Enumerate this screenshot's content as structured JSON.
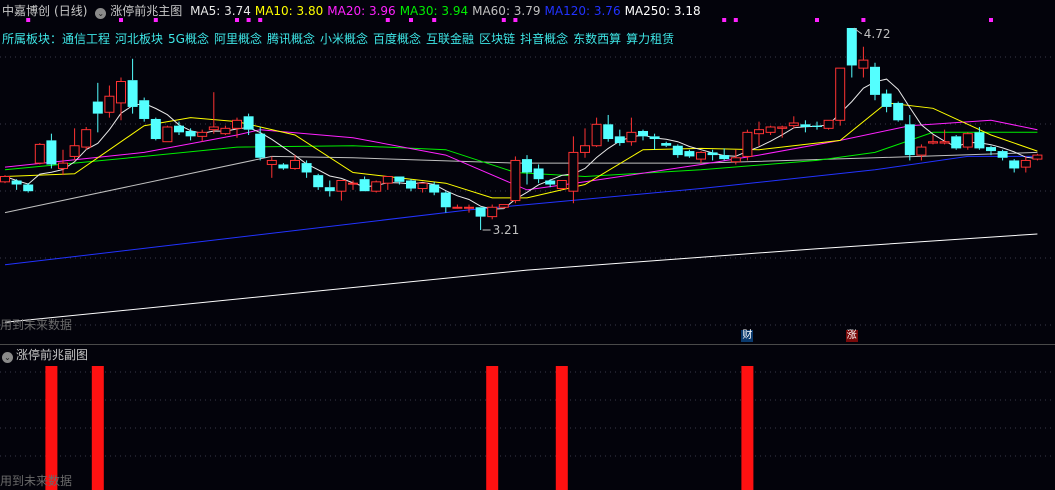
{
  "header": {
    "stock_name": "中嘉博创",
    "period": "(日线)",
    "indicator": "涨停前兆主图",
    "ma": [
      {
        "label": "MA5: 3.74",
        "color": "#e8e8e8"
      },
      {
        "label": "MA10: 3.80",
        "color": "#ffff00"
      },
      {
        "label": "MA20: 3.96",
        "color": "#ff22ff"
      },
      {
        "label": "MA30: 3.94",
        "color": "#00ee00"
      },
      {
        "label": "MA60: 3.79",
        "color": "#c0c0c0"
      },
      {
        "label": "MA120: 3.76",
        "color": "#2233ff"
      },
      {
        "label": "MA250: 3.18",
        "color": "#ffffff"
      }
    ]
  },
  "sectors": {
    "label": "所属板块：",
    "items": [
      "通信工程",
      "河北板块",
      "5G概念",
      "阿里概念",
      "腾讯概念",
      "小米概念",
      "百度概念",
      "互联金融",
      "区块链",
      "抖音概念",
      "东数西算",
      "算力租赁"
    ]
  },
  "warning_label": "用到未来数据",
  "sub_panel": {
    "title": "涨停前兆副图",
    "signal_bars": [
      4,
      8,
      42,
      48,
      64
    ],
    "bar_color": "#ff1111"
  },
  "badges": [
    {
      "text": "财",
      "index": 64,
      "color": "#0a3a6e"
    },
    {
      "text": "涨",
      "index": 73,
      "color": "#7a0a0a"
    }
  ],
  "chart_data": {
    "type": "candlestick",
    "up_color": "#ff3333",
    "down_color": "#54ffff",
    "price_range": [
      2.4,
      4.86
    ],
    "high_label": {
      "index": 73,
      "text": "4.72"
    },
    "low_label": {
      "index": 41,
      "text": "3.21"
    },
    "signal_dots": [
      2,
      10,
      13,
      20,
      21,
      22,
      33,
      35,
      37,
      43,
      44,
      62,
      63,
      70,
      74,
      85
    ],
    "ohlc": [
      [
        3.57,
        3.62,
        3.56,
        3.61
      ],
      [
        3.58,
        3.59,
        3.51,
        3.55
      ],
      [
        3.55,
        3.56,
        3.49,
        3.5
      ],
      [
        3.71,
        3.86,
        3.7,
        3.85
      ],
      [
        3.88,
        3.93,
        3.67,
        3.7
      ],
      [
        3.67,
        3.81,
        3.62,
        3.71
      ],
      [
        3.76,
        3.97,
        3.73,
        3.84
      ],
      [
        3.83,
        3.98,
        3.81,
        3.96
      ],
      [
        4.17,
        4.31,
        3.94,
        4.08
      ],
      [
        4.09,
        4.29,
        4.05,
        4.21
      ],
      [
        4.16,
        4.35,
        4.03,
        4.32
      ],
      [
        4.33,
        4.49,
        4.08,
        4.13
      ],
      [
        4.18,
        4.2,
        4.02,
        4.04
      ],
      [
        4.04,
        4.05,
        3.88,
        3.89
      ],
      [
        3.87,
        3.99,
        3.87,
        3.98
      ],
      [
        3.99,
        4.02,
        3.92,
        3.94
      ],
      [
        3.95,
        3.97,
        3.88,
        3.91
      ],
      [
        3.91,
        3.96,
        3.87,
        3.94
      ],
      [
        3.96,
        4.24,
        3.93,
        3.98
      ],
      [
        3.93,
        3.99,
        3.92,
        3.97
      ],
      [
        3.97,
        4.05,
        3.9,
        4.03
      ],
      [
        4.06,
        4.08,
        3.92,
        3.96
      ],
      [
        3.93,
        3.98,
        3.73,
        3.75
      ],
      [
        3.7,
        3.76,
        3.6,
        3.73
      ],
      [
        3.7,
        3.71,
        3.66,
        3.67
      ],
      [
        3.67,
        3.77,
        3.66,
        3.73
      ],
      [
        3.71,
        3.73,
        3.6,
        3.64
      ],
      [
        3.62,
        3.63,
        3.51,
        3.53
      ],
      [
        3.53,
        3.58,
        3.46,
        3.5
      ],
      [
        3.5,
        3.58,
        3.43,
        3.58
      ],
      [
        3.56,
        3.58,
        3.51,
        3.56
      ],
      [
        3.59,
        3.61,
        3.5,
        3.5
      ],
      [
        3.5,
        3.58,
        3.49,
        3.57
      ],
      [
        3.56,
        3.61,
        3.51,
        3.61
      ],
      [
        3.61,
        3.61,
        3.55,
        3.57
      ],
      [
        3.58,
        3.59,
        3.5,
        3.52
      ],
      [
        3.52,
        3.56,
        3.49,
        3.56
      ],
      [
        3.55,
        3.57,
        3.47,
        3.49
      ],
      [
        3.49,
        3.5,
        3.34,
        3.38
      ],
      [
        3.38,
        3.4,
        3.37,
        3.38
      ],
      [
        3.38,
        3.4,
        3.34,
        3.38
      ],
      [
        3.38,
        3.38,
        3.21,
        3.31
      ],
      [
        3.31,
        3.4,
        3.29,
        3.38
      ],
      [
        3.38,
        3.4,
        3.37,
        3.4
      ],
      [
        3.43,
        3.76,
        3.41,
        3.73
      ],
      [
        3.74,
        3.77,
        3.55,
        3.64
      ],
      [
        3.67,
        3.7,
        3.56,
        3.59
      ],
      [
        3.58,
        3.59,
        3.53,
        3.55
      ],
      [
        3.52,
        3.58,
        3.51,
        3.58
      ],
      [
        3.5,
        3.91,
        3.41,
        3.79
      ],
      [
        3.79,
        3.97,
        3.75,
        3.84
      ],
      [
        3.84,
        4.05,
        3.83,
        4.0
      ],
      [
        4.0,
        4.07,
        3.87,
        3.89
      ],
      [
        3.91,
        3.96,
        3.84,
        3.86
      ],
      [
        3.87,
        4.05,
        3.84,
        3.94
      ],
      [
        3.95,
        3.96,
        3.88,
        3.91
      ],
      [
        3.91,
        3.93,
        3.81,
        3.89
      ],
      [
        3.86,
        3.87,
        3.83,
        3.84
      ],
      [
        3.84,
        3.85,
        3.75,
        3.77
      ],
      [
        3.8,
        3.81,
        3.75,
        3.76
      ],
      [
        3.74,
        3.8,
        3.71,
        3.79
      ],
      [
        3.79,
        3.81,
        3.73,
        3.77
      ],
      [
        3.77,
        3.82,
        3.73,
        3.74
      ],
      [
        3.72,
        3.81,
        3.7,
        3.75
      ],
      [
        3.76,
        3.96,
        3.73,
        3.94
      ],
      [
        3.93,
        4.02,
        3.84,
        3.96
      ],
      [
        3.94,
        3.99,
        3.92,
        3.98
      ],
      [
        3.97,
        3.99,
        3.9,
        3.98
      ],
      [
        3.99,
        4.06,
        3.97,
        4.01
      ],
      [
        4.0,
        4.03,
        3.94,
        3.98
      ],
      [
        3.99,
        4.02,
        3.96,
        3.98
      ],
      [
        3.97,
        4.03,
        3.96,
        4.03
      ],
      [
        4.03,
        4.42,
        3.99,
        4.42
      ],
      [
        4.72,
        4.72,
        4.35,
        4.44
      ],
      [
        4.42,
        4.58,
        4.35,
        4.48
      ],
      [
        4.43,
        4.46,
        4.18,
        4.22
      ],
      [
        4.23,
        4.26,
        4.09,
        4.13
      ],
      [
        4.16,
        4.17,
        4.02,
        4.03
      ],
      [
        4.0,
        4.07,
        3.73,
        3.77
      ],
      [
        3.77,
        3.85,
        3.73,
        3.83
      ],
      [
        3.86,
        3.92,
        3.85,
        3.87
      ],
      [
        3.86,
        3.96,
        3.85,
        3.87
      ],
      [
        3.91,
        3.92,
        3.81,
        3.82
      ],
      [
        3.83,
        3.94,
        3.81,
        3.93
      ],
      [
        3.94,
        3.98,
        3.81,
        3.82
      ],
      [
        3.83,
        3.84,
        3.77,
        3.8
      ],
      [
        3.8,
        3.81,
        3.73,
        3.75
      ],
      [
        3.73,
        3.74,
        3.64,
        3.67
      ],
      [
        3.68,
        3.76,
        3.64,
        3.73
      ],
      [
        3.74,
        3.78,
        3.73,
        3.77
      ]
    ],
    "ma_lines": [
      {
        "name": "MA10",
        "color": "#ffff00",
        "points": [
          [
            0,
            3.61
          ],
          [
            6,
            3.63
          ],
          [
            12,
            3.99
          ],
          [
            16,
            4.05
          ],
          [
            20,
            4.02
          ],
          [
            25,
            3.92
          ],
          [
            30,
            3.64
          ],
          [
            38,
            3.56
          ],
          [
            42,
            3.45
          ],
          [
            45,
            3.45
          ],
          [
            50,
            3.55
          ],
          [
            55,
            3.81
          ],
          [
            60,
            3.82
          ],
          [
            65,
            3.81
          ],
          [
            72,
            3.88
          ],
          [
            76,
            4.16
          ],
          [
            80,
            4.12
          ],
          [
            85,
            3.92
          ],
          [
            89,
            3.8
          ]
        ]
      },
      {
        "name": "MA20",
        "color": "#ff22ff",
        "points": [
          [
            0,
            3.68
          ],
          [
            12,
            3.79
          ],
          [
            20,
            3.92
          ],
          [
            22,
            3.96
          ],
          [
            30,
            3.9
          ],
          [
            38,
            3.77
          ],
          [
            45,
            3.51
          ],
          [
            50,
            3.57
          ],
          [
            60,
            3.7
          ],
          [
            65,
            3.77
          ],
          [
            72,
            3.88
          ],
          [
            78,
            3.99
          ],
          [
            85,
            4.03
          ],
          [
            89,
            3.96
          ]
        ]
      },
      {
        "name": "MA30",
        "color": "#00ee00",
        "points": [
          [
            0,
            3.66
          ],
          [
            12,
            3.76
          ],
          [
            20,
            3.83
          ],
          [
            30,
            3.84
          ],
          [
            38,
            3.81
          ],
          [
            44,
            3.64
          ],
          [
            50,
            3.61
          ],
          [
            60,
            3.66
          ],
          [
            70,
            3.73
          ],
          [
            75,
            3.79
          ],
          [
            80,
            3.94
          ],
          [
            89,
            3.94
          ]
        ]
      },
      {
        "name": "MA60",
        "color": "#c0c0c0",
        "points": [
          [
            0,
            3.34
          ],
          [
            23,
            3.76
          ],
          [
            30,
            3.75
          ],
          [
            44,
            3.71
          ],
          [
            60,
            3.71
          ],
          [
            75,
            3.75
          ],
          [
            89,
            3.79
          ]
        ]
      },
      {
        "name": "MA120",
        "color": "#2233ff",
        "points": [
          [
            0,
            2.95
          ],
          [
            40,
            3.36
          ],
          [
            45,
            3.4
          ],
          [
            60,
            3.52
          ],
          [
            75,
            3.66
          ],
          [
            83,
            3.76
          ],
          [
            89,
            3.76
          ]
        ]
      },
      {
        "name": "MA250",
        "color": "#ffffff",
        "points": [
          [
            0,
            2.52
          ],
          [
            45,
            2.91
          ],
          [
            70,
            3.07
          ],
          [
            89,
            3.18
          ]
        ]
      }
    ],
    "ma5": {
      "name": "MA5",
      "color": "#e8e8e8",
      "period": 5
    }
  }
}
